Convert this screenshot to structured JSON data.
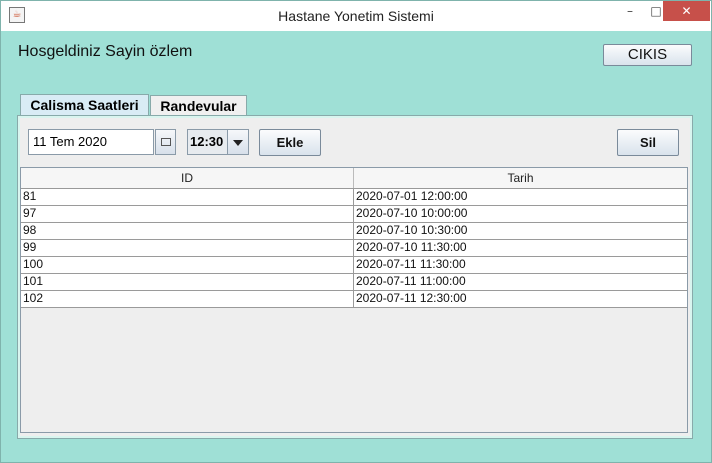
{
  "window": {
    "title": "Hastane Yonetim Sistemi",
    "app_icon": "java-icon",
    "controls": {
      "minimize": "–",
      "maximize": "□",
      "close": "✕"
    }
  },
  "header": {
    "welcome": "Hosgeldiniz Sayin özlem",
    "exit_button": "CIKIS"
  },
  "tabs": [
    {
      "label": "Calisma Saatleri",
      "active": true
    },
    {
      "label": "Randevular",
      "active": false
    }
  ],
  "toolbar": {
    "date_value": "11 Tem 2020",
    "time_value": "12:30",
    "add_button": "Ekle",
    "delete_button": "Sil"
  },
  "table": {
    "columns": [
      "ID",
      "Tarih"
    ],
    "rows": [
      {
        "id": "81",
        "tarih": "2020-07-01 12:00:00"
      },
      {
        "id": "97",
        "tarih": "2020-07-10 10:00:00"
      },
      {
        "id": "98",
        "tarih": "2020-07-10 10:30:00"
      },
      {
        "id": "99",
        "tarih": "2020-07-10 11:30:00"
      },
      {
        "id": "100",
        "tarih": "2020-07-11 11:30:00"
      },
      {
        "id": "101",
        "tarih": "2020-07-11 11:00:00"
      },
      {
        "id": "102",
        "tarih": "2020-07-11 12:30:00"
      }
    ]
  },
  "colors": {
    "window_bg": "#9fe0d6",
    "panel_bg": "#eeeeee",
    "close_button": "#c7504a"
  }
}
